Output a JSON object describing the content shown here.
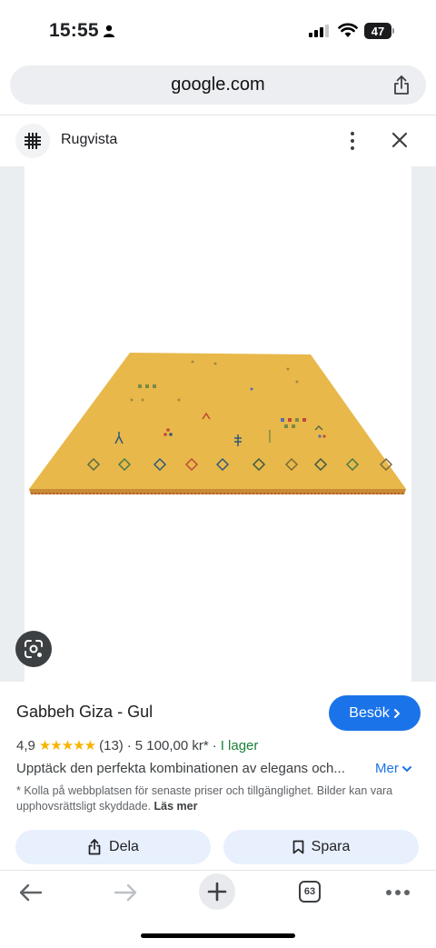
{
  "status_bar": {
    "time": "15:55",
    "battery": "47"
  },
  "browser": {
    "url": "google.com"
  },
  "site": {
    "name": "Rugvista"
  },
  "product": {
    "title": "Gabbeh Giza - Gul",
    "visit_label": "Besök",
    "rating": "4,9",
    "stars": "★★★★★",
    "review_count": "(13)",
    "separator": "·",
    "price": "5 100,00 kr*",
    "availability": "I lager",
    "description": "Upptäck den perfekta kombinationen av elegans och...",
    "more_label": "Mer",
    "disclaimer": "* Kolla på webbplatsen för senaste priser och tillgänglighet. Bilder kan vara upphovsrättsligt skyddade.",
    "read_more_label": "Läs mer",
    "share_label": "Dela",
    "save_label": "Spara"
  },
  "toolbar": {
    "tab_count": "63"
  },
  "colors": {
    "accent": "#1a73e8",
    "rug": "#e8b84a",
    "stock": "#188038",
    "star": "#f6b400"
  }
}
